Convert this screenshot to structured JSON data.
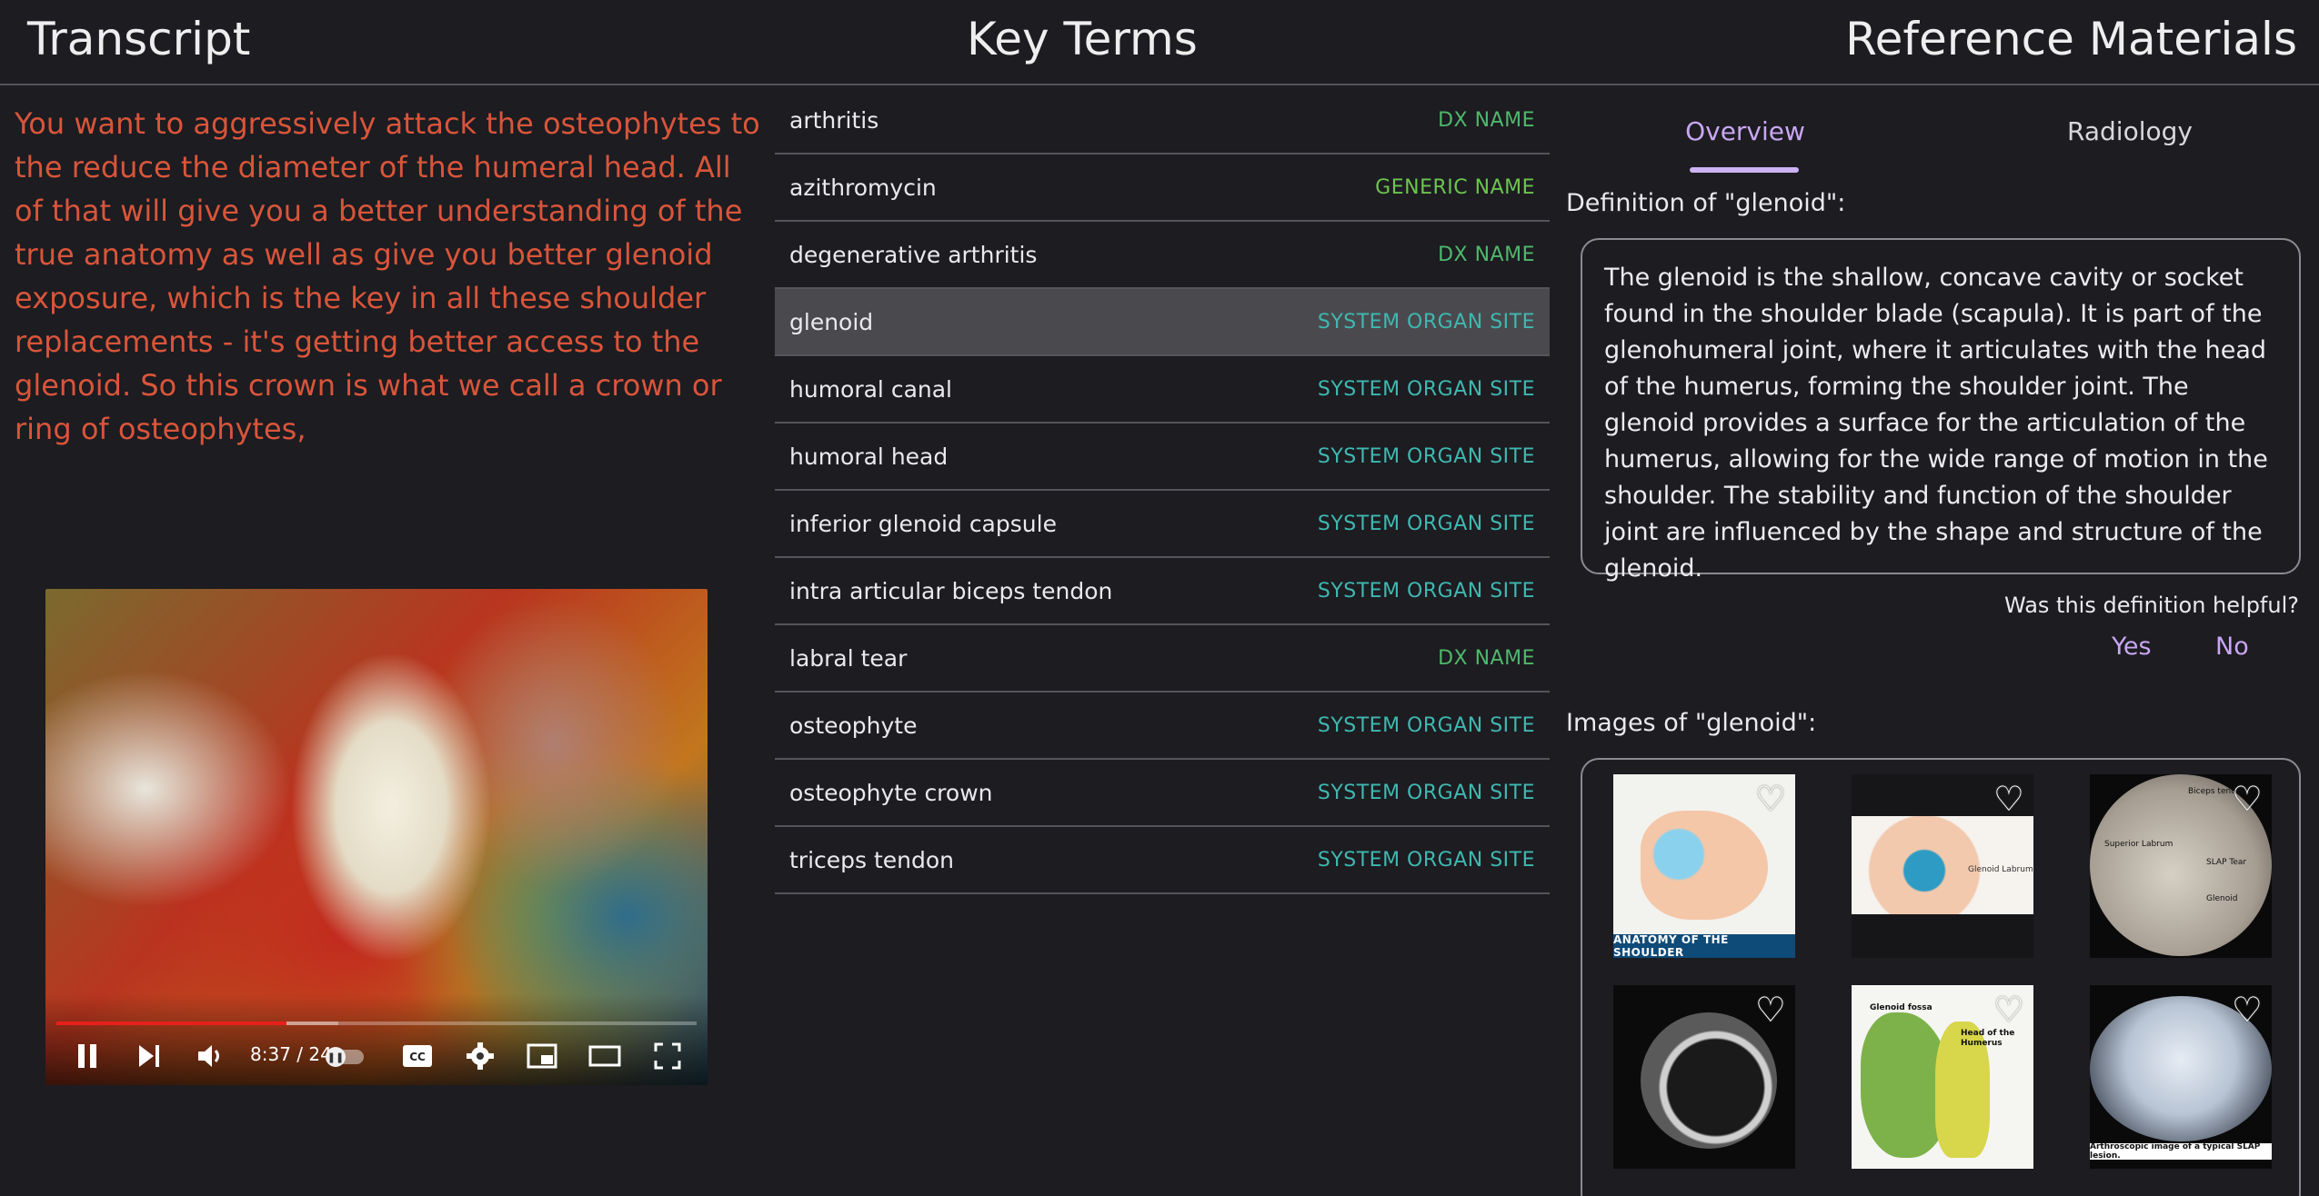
{
  "header": {
    "transcript_title": "Transcript",
    "key_terms_title": "Key Terms",
    "reference_title": "Reference Materials"
  },
  "transcript": {
    "text": "You want to aggressively attack the osteophytes to the reduce the diameter of the humeral head. All of that will give you a better understanding of the true anatomy as well as give you better glenoid exposure, which is the key in all these shoulder replacements - it's getting better access to the glenoid. So this crown is what we call a crown or ring of osteophytes,"
  },
  "video": {
    "time": "8:37 / 24",
    "progress": 0.36,
    "buffered": 0.08,
    "icons": [
      "pause-icon",
      "next-icon",
      "volume-icon",
      "autoplay-toggle",
      "captions-icon",
      "settings-icon",
      "miniplayer-icon",
      "theater-icon",
      "fullscreen-icon"
    ]
  },
  "key_terms": [
    {
      "name": "arthritis",
      "category": "DX NAME",
      "kind": "dx"
    },
    {
      "name": "azithromycin",
      "category": "GENERIC NAME",
      "kind": "generic"
    },
    {
      "name": "degenerative arthritis",
      "category": "DX NAME",
      "kind": "dx"
    },
    {
      "name": "glenoid",
      "category": "SYSTEM ORGAN SITE",
      "kind": "site",
      "selected": true
    },
    {
      "name": "humoral canal",
      "category": "SYSTEM ORGAN SITE",
      "kind": "site"
    },
    {
      "name": "humoral head",
      "category": "SYSTEM ORGAN SITE",
      "kind": "site"
    },
    {
      "name": "inferior glenoid capsule",
      "category": "SYSTEM ORGAN SITE",
      "kind": "site"
    },
    {
      "name": "intra articular biceps tendon",
      "category": "SYSTEM ORGAN SITE",
      "kind": "site"
    },
    {
      "name": "labral tear",
      "category": "DX NAME",
      "kind": "dx"
    },
    {
      "name": "osteophyte",
      "category": "SYSTEM ORGAN SITE",
      "kind": "site"
    },
    {
      "name": "osteophyte crown",
      "category": "SYSTEM ORGAN SITE",
      "kind": "site"
    },
    {
      "name": "triceps tendon",
      "category": "SYSTEM ORGAN SITE",
      "kind": "site"
    }
  ],
  "reference": {
    "tabs": [
      "Overview",
      "Radiology"
    ],
    "active_tab": "Overview",
    "definition_heading": "Definition of \"glenoid\":",
    "definition": "The glenoid is the shallow, concave cavity or socket found in the shoulder blade (scapula). It is part of the glenohumeral joint, where it articulates with the head of the humerus, forming the shoulder joint. The glenoid provides a surface for the articulation of the humerus, allowing for the wide range of motion in the shoulder. The stability and function of the shoulder joint are influenced by the shape and structure of the glenoid.",
    "helpful_question": "Was this definition helpful?",
    "yes_label": "Yes",
    "no_label": "No",
    "images_heading": "Images of \"glenoid\":",
    "images": [
      {
        "caption": "ANATOMY OF THE SHOULDER"
      },
      {
        "caption": "Glenoid Labrum"
      },
      {
        "caption": "SLAP Tear",
        "labels": [
          "Biceps tendon",
          "Superior Labrum",
          "Glenoid"
        ]
      },
      {
        "caption": ""
      },
      {
        "caption": "",
        "labels": [
          "Glenoid fossa",
          "Head of the Humerus"
        ]
      },
      {
        "caption": "Arthroscopic image of a typical SLAP lesion."
      }
    ]
  }
}
